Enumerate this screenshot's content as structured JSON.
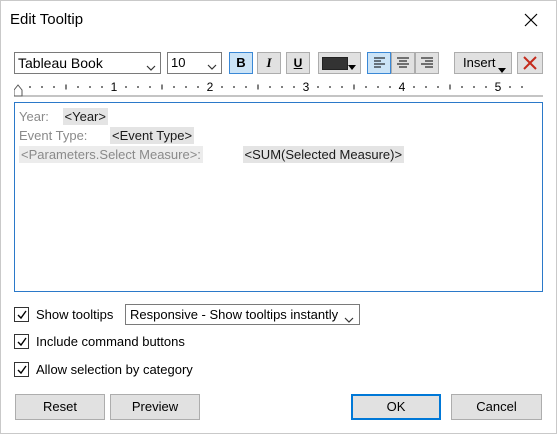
{
  "window": {
    "title": "Edit Tooltip"
  },
  "toolbar": {
    "font": "Tableau Book",
    "size": "10",
    "bold_label": "B",
    "italic_label": "I",
    "underline_label": "U",
    "font_color": "#333333",
    "insert_label": "Insert",
    "ruler_numbers": [
      "1",
      "2",
      "3",
      "4",
      "5"
    ]
  },
  "editor": {
    "line1": {
      "label": "Year:",
      "field": "<Year>"
    },
    "line2": {
      "label": "Event Type:",
      "field": "<Event Type>"
    },
    "line3": {
      "label": "<Parameters.Select Measure>:",
      "field": "<SUM(Selected Measure)>"
    }
  },
  "options": {
    "show_tooltips": {
      "label": "Show tooltips",
      "checked": true
    },
    "tooltip_mode": "Responsive - Show tooltips instantly",
    "include_command_buttons": {
      "label": "Include command buttons",
      "checked": true
    },
    "allow_selection": {
      "label": "Allow selection by category",
      "checked": true
    }
  },
  "buttons": {
    "reset": "Reset",
    "preview": "Preview",
    "ok": "OK",
    "cancel": "Cancel"
  },
  "colors": {
    "accent": "#0078d7",
    "selected_fill": "#cce4f7",
    "clear_icon": "#c42b1c"
  }
}
